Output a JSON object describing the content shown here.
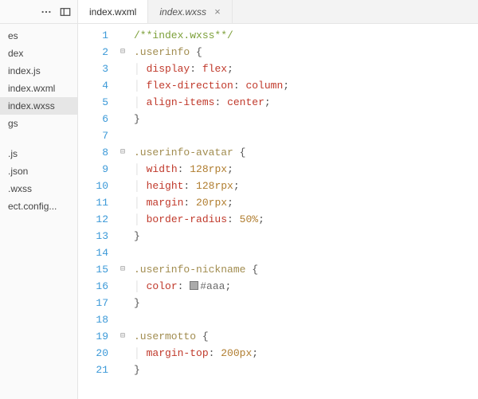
{
  "sidebar": {
    "items": [
      {
        "label": "es"
      },
      {
        "label": "dex"
      },
      {
        "label": "index.js"
      },
      {
        "label": "index.wxml"
      },
      {
        "label": "index.wxss",
        "selected": true
      },
      {
        "label": "gs"
      },
      {
        "label": ".js"
      },
      {
        "label": ".json"
      },
      {
        "label": ".wxss"
      },
      {
        "label": "ect.config..."
      }
    ]
  },
  "tabs": [
    {
      "label": "index.wxml",
      "active": true
    },
    {
      "label": "index.wxss",
      "italic": true,
      "closable": true
    }
  ],
  "code": {
    "lines": [
      {
        "n": 1,
        "fold": "",
        "html": "<span class='tok-comment'>/**index.wxss**/</span>"
      },
      {
        "n": 2,
        "fold": "⊟",
        "html": "<span class='tok-sel'>.userinfo</span> <span class='tok-punc'>{</span>"
      },
      {
        "n": 3,
        "fold": "",
        "html": "<span class='guide'>│ </span><span class='tok-prop'>display</span><span class='tok-punc'>:</span> <span class='tok-val'>flex</span><span class='tok-punc'>;</span>"
      },
      {
        "n": 4,
        "fold": "",
        "html": "<span class='guide'>│ </span><span class='tok-prop'>flex-direction</span><span class='tok-punc'>:</span> <span class='tok-val'>column</span><span class='tok-punc'>;</span>"
      },
      {
        "n": 5,
        "fold": "",
        "html": "<span class='guide'>│ </span><span class='tok-prop'>align-items</span><span class='tok-punc'>:</span> <span class='tok-val'>center</span><span class='tok-punc'>;</span>"
      },
      {
        "n": 6,
        "fold": "",
        "html": "<span class='tok-punc'>}</span>"
      },
      {
        "n": 7,
        "fold": "",
        "html": ""
      },
      {
        "n": 8,
        "fold": "⊟",
        "html": "<span class='tok-sel'>.userinfo-avatar</span> <span class='tok-punc'>{</span>"
      },
      {
        "n": 9,
        "fold": "",
        "html": "<span class='guide'>│ </span><span class='tok-prop'>width</span><span class='tok-punc'>:</span> <span class='tok-num'>128rpx</span><span class='tok-punc'>;</span>"
      },
      {
        "n": 10,
        "fold": "",
        "html": "<span class='guide'>│ </span><span class='tok-prop'>height</span><span class='tok-punc'>:</span> <span class='tok-num'>128rpx</span><span class='tok-punc'>;</span>"
      },
      {
        "n": 11,
        "fold": "",
        "html": "<span class='guide'>│ </span><span class='tok-prop'>margin</span><span class='tok-punc'>:</span> <span class='tok-num'>20rpx</span><span class='tok-punc'>;</span>"
      },
      {
        "n": 12,
        "fold": "",
        "html": "<span class='guide'>│ </span><span class='tok-prop'>border-radius</span><span class='tok-punc'>:</span> <span class='tok-num'>50%</span><span class='tok-punc'>;</span>"
      },
      {
        "n": 13,
        "fold": "",
        "html": "<span class='tok-punc'>}</span>"
      },
      {
        "n": 14,
        "fold": "",
        "html": ""
      },
      {
        "n": 15,
        "fold": "⊟",
        "html": "<span class='tok-sel'>.userinfo-nickname</span> <span class='tok-punc'>{</span>"
      },
      {
        "n": 16,
        "fold": "",
        "html": "<span class='guide'>│ </span><span class='tok-prop'>color</span><span class='tok-punc'>:</span> <span class='swatch'></span><span class='tok-colorval'>#aaa</span><span class='tok-punc'>;</span>"
      },
      {
        "n": 17,
        "fold": "",
        "html": "<span class='tok-punc'>}</span>"
      },
      {
        "n": 18,
        "fold": "",
        "html": ""
      },
      {
        "n": 19,
        "fold": "⊟",
        "html": "<span class='tok-sel'>.usermotto</span> <span class='tok-punc'>{</span>"
      },
      {
        "n": 20,
        "fold": "",
        "html": "<span class='guide'>│ </span><span class='tok-prop'>margin-top</span><span class='tok-punc'>:</span> <span class='tok-num'>200px</span><span class='tok-punc'>;</span>"
      },
      {
        "n": 21,
        "fold": "",
        "html": "<span class='tok-punc'>}</span>"
      }
    ]
  }
}
